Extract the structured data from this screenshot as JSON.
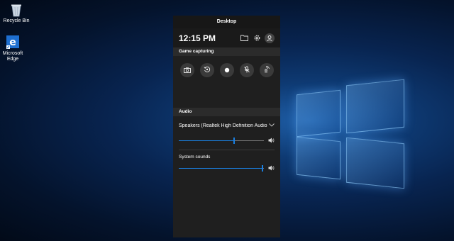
{
  "desktop": {
    "icons": [
      {
        "label": "Recycle Bin",
        "icon": "recycle-bin-icon"
      },
      {
        "label": "Microsoft Edge",
        "icon": "edge-icon"
      }
    ]
  },
  "panel": {
    "title": "Desktop",
    "time": "12:15 PM",
    "top_icons": [
      "folder-icon",
      "gear-icon",
      "profile-icon"
    ],
    "game_capture": {
      "heading": "Game capturing",
      "buttons": [
        "screenshot-icon",
        "record-last-icon",
        "record-icon",
        "mic-off-icon",
        "broadcast-icon"
      ]
    },
    "audio": {
      "heading": "Audio",
      "device": "Speakers (Realtek High Definition Audio",
      "device_volume": 0.65,
      "system_sounds_label": "System sounds",
      "system_volume": 0.98
    }
  },
  "colors": {
    "accent": "#1a7fe0",
    "panel_bg": "#1f1f1f"
  }
}
